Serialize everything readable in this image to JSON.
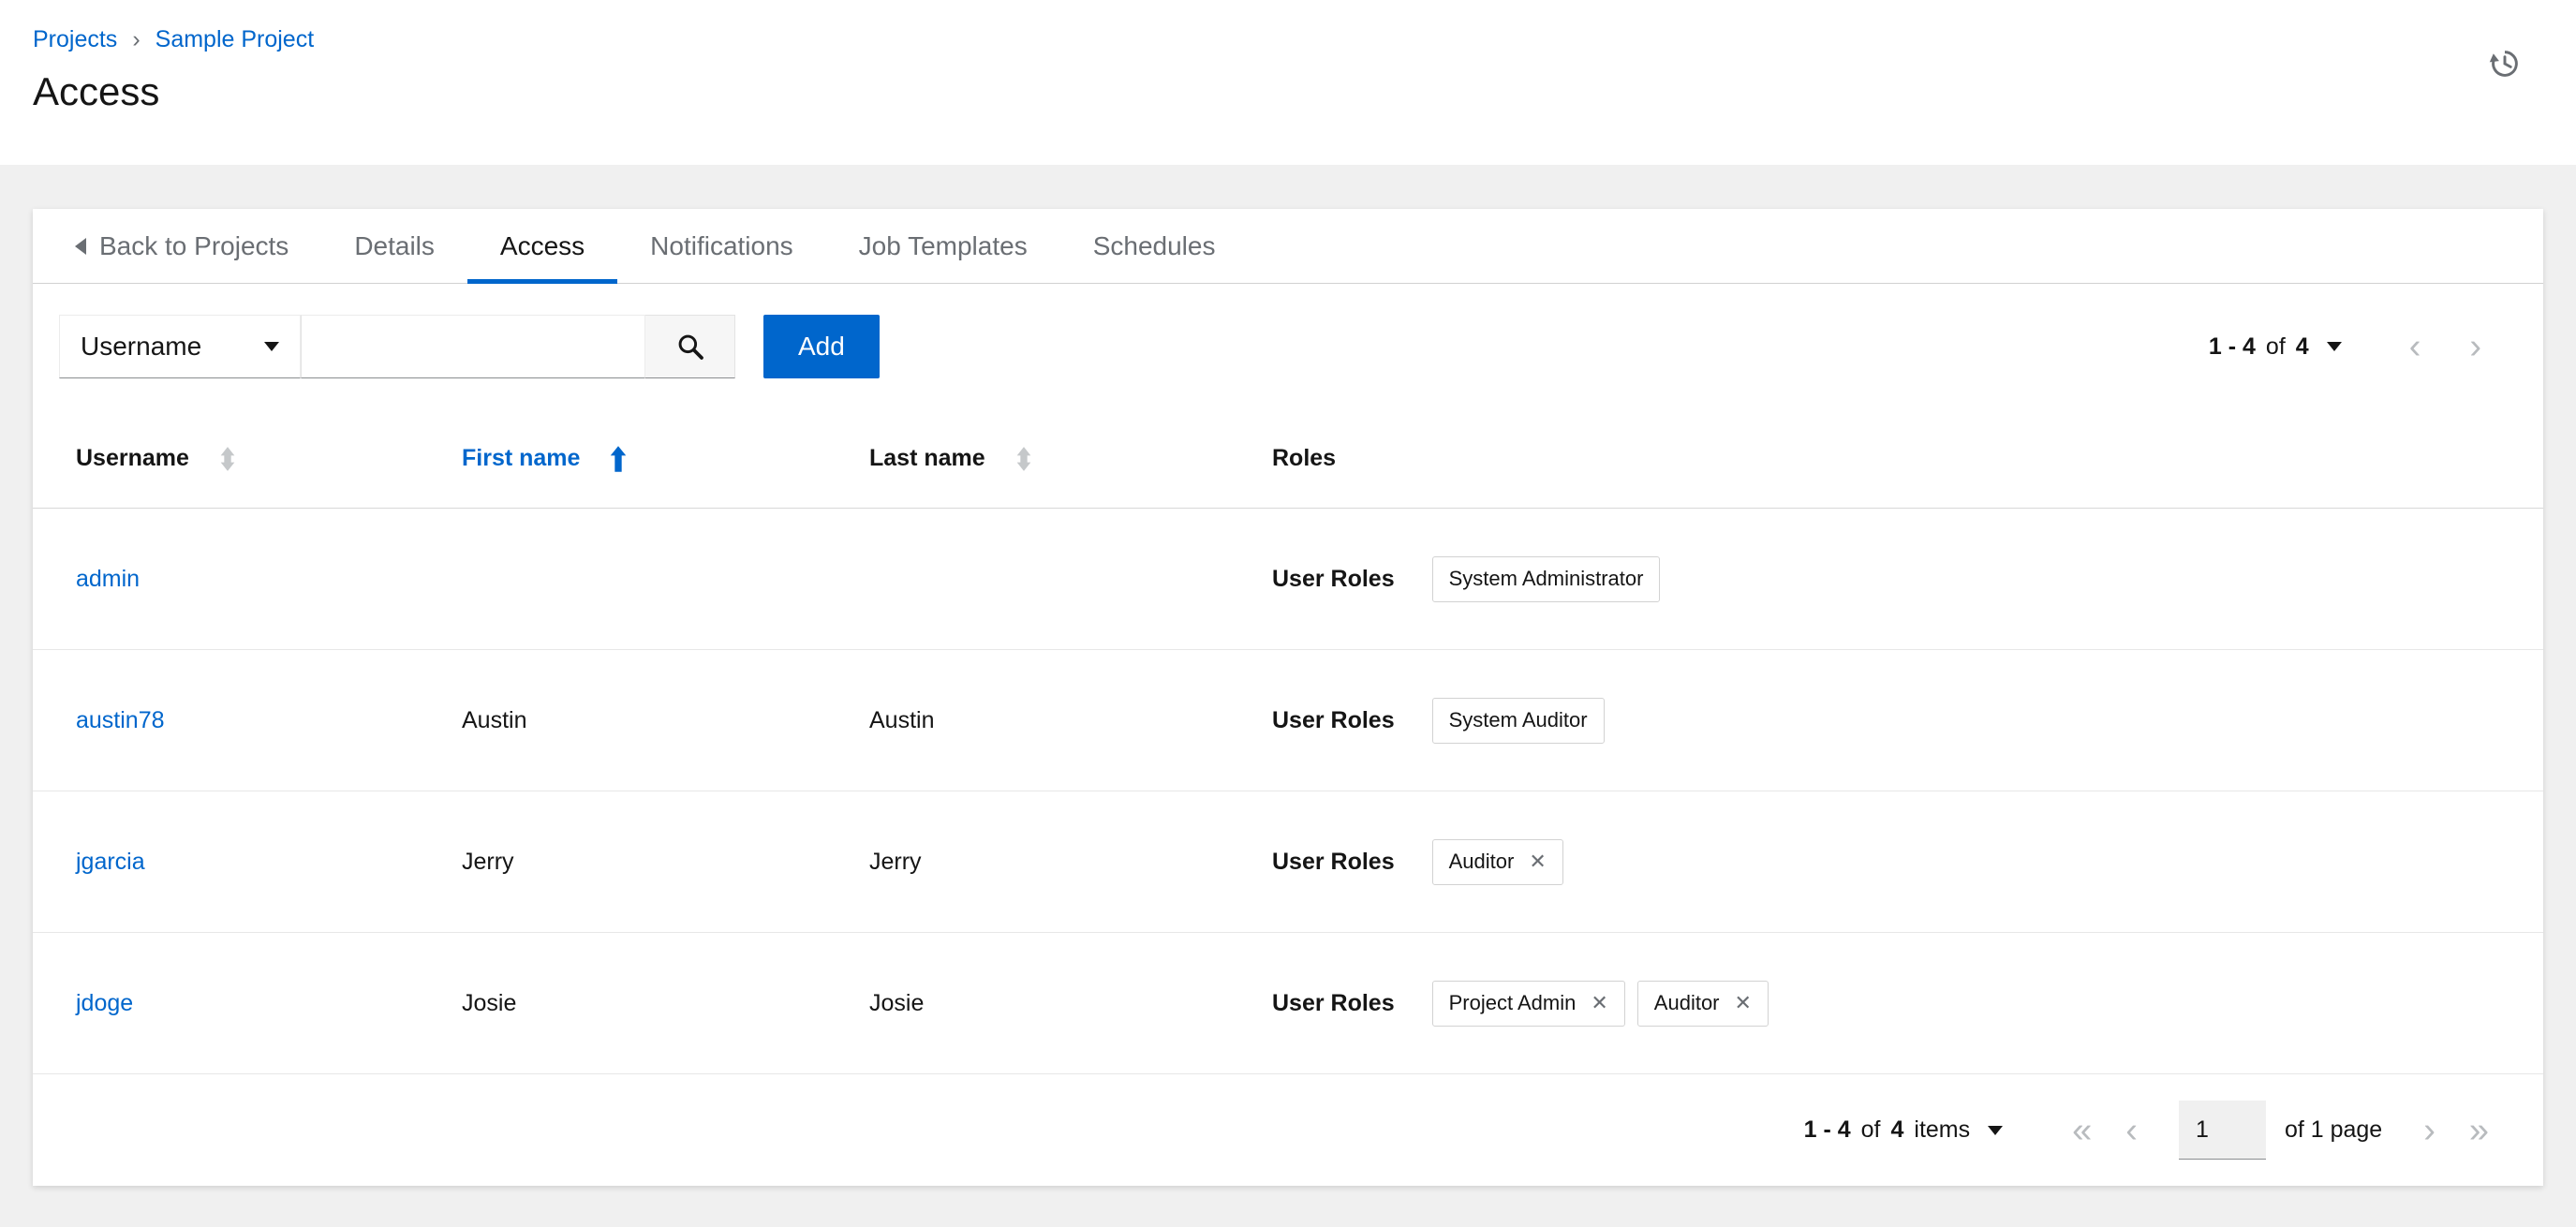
{
  "header": {
    "breadcrumb": {
      "projects": "Projects",
      "separator": "›",
      "current": "Sample Project"
    },
    "title": "Access"
  },
  "tabs": {
    "back_label": "Back to Projects",
    "items": [
      "Details",
      "Access",
      "Notifications",
      "Job Templates",
      "Schedules"
    ],
    "active_tab": "Access"
  },
  "toolbar": {
    "filter": {
      "selected": "Username"
    },
    "search_value": "",
    "add_label": "Add",
    "pagination": {
      "range": "1 - 4",
      "of": "of",
      "total": "4"
    }
  },
  "table": {
    "headers": {
      "username": "Username",
      "first": "First name",
      "last": "Last name",
      "roles": "Roles"
    },
    "sort": {
      "column": "First name",
      "direction": "ascending"
    },
    "roles_label": "User Roles",
    "rows": [
      {
        "username": "admin",
        "first": "",
        "last": "",
        "roles": [
          {
            "name": "System Administrator",
            "removable": false
          }
        ]
      },
      {
        "username": "austin78",
        "first": "Austin",
        "last": "Austin",
        "roles": [
          {
            "name": "System Auditor",
            "removable": false
          }
        ]
      },
      {
        "username": "jgarcia",
        "first": "Jerry",
        "last": "Jerry",
        "roles": [
          {
            "name": "Auditor",
            "removable": true
          }
        ]
      },
      {
        "username": "jdoge",
        "first": "Josie",
        "last": "Josie",
        "roles": [
          {
            "name": "Project Admin",
            "removable": true
          },
          {
            "name": "Auditor",
            "removable": true
          }
        ]
      }
    ]
  },
  "footer": {
    "pagination": {
      "range": "1 - 4",
      "of": "of",
      "total": "4",
      "items": "items",
      "page": "1",
      "page_of": "of 1 page"
    }
  },
  "icons": {
    "remove": "✕",
    "angle_left": "‹",
    "angle_right": "›",
    "angle_double_left": "«",
    "angle_double_right": "»"
  },
  "colors": {
    "primary": "#0066cc",
    "text": "#151515",
    "muted": "#6a6e73",
    "border": "#d2d2d2",
    "background": "#f0f0f0"
  }
}
